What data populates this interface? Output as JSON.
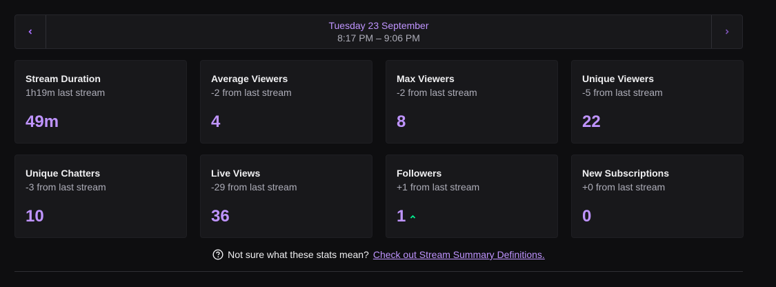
{
  "date_nav": {
    "prev_icon": "chevron-left-icon",
    "next_icon": "chevron-right-icon",
    "date": "Tuesday 23 September",
    "time_range": "8:17 PM – 9:06 PM"
  },
  "stats": [
    {
      "title": "Stream Duration",
      "sub": "1h19m last stream",
      "value": "49m"
    },
    {
      "title": "Average Viewers",
      "sub": "-2 from last stream",
      "value": "4"
    },
    {
      "title": "Max Viewers",
      "sub": "-2 from last stream",
      "value": "8"
    },
    {
      "title": "Unique Viewers",
      "sub": "-5 from last stream",
      "value": "22"
    },
    {
      "title": "Unique Chatters",
      "sub": "-3 from last stream",
      "value": "10"
    },
    {
      "title": "Live Views",
      "sub": "-29 from last stream",
      "value": "36"
    },
    {
      "title": "Followers",
      "sub": "+1 from last stream",
      "value": "1",
      "trend_icon": "up-arrow-icon"
    },
    {
      "title": "New Subscriptions",
      "sub": "+0 from last stream",
      "value": "0"
    }
  ],
  "help": {
    "icon": "question-circle-icon",
    "text": "Not sure what these stats mean?",
    "link_text": "Check out Stream Summary Definitions."
  },
  "colors": {
    "accent": "#bf94ff",
    "positive": "#00f593",
    "background": "#0e0e10",
    "card": "#18181b"
  }
}
